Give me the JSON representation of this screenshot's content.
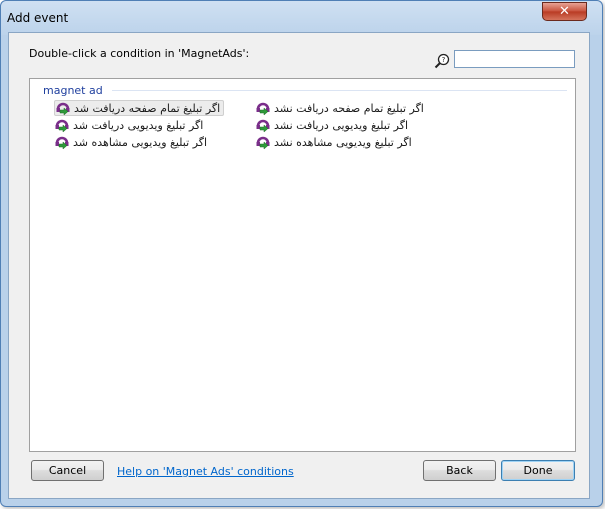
{
  "window": {
    "title": "Add event",
    "close_glyph": "✕"
  },
  "prompt": "Double-click a condition in 'MagnetAds':",
  "search": {
    "value": "",
    "icon": "search-help-icon"
  },
  "group": {
    "label": "magnet ad"
  },
  "conditions": [
    {
      "label": "اگر تبلیغ تمام صفحه دریافت شد",
      "icon": "magnet-ad-condition-icon",
      "selected": true
    },
    {
      "label": "اگر تبلیغ تمام صفحه دریافت نشد",
      "icon": "magnet-ad-condition-icon",
      "selected": false
    },
    {
      "label": "اگر تبلیغ ویدیویی دریافت شد",
      "icon": "magnet-ad-condition-icon",
      "selected": false
    },
    {
      "label": "اگر تبلیغ ویدیویی دریافت نشد",
      "icon": "magnet-ad-condition-icon",
      "selected": false
    },
    {
      "label": "اگر تبلیغ ویدیویی مشاهده شد",
      "icon": "magnet-ad-condition-icon",
      "selected": false
    },
    {
      "label": "اگر تبلیغ ویدیویی مشاهده نشد",
      "icon": "magnet-ad-condition-icon",
      "selected": false
    }
  ],
  "buttons": {
    "cancel": "Cancel",
    "help": "Help on 'Magnet Ads' conditions",
    "back": "Back",
    "done": "Done"
  },
  "colors": {
    "frame": "#b9d1ea",
    "client": "#f0f0f0",
    "group_header": "#1f3f9e",
    "link": "#0066cc",
    "icon_purple": "#7a2e8a",
    "icon_green": "#2e9a3a"
  }
}
